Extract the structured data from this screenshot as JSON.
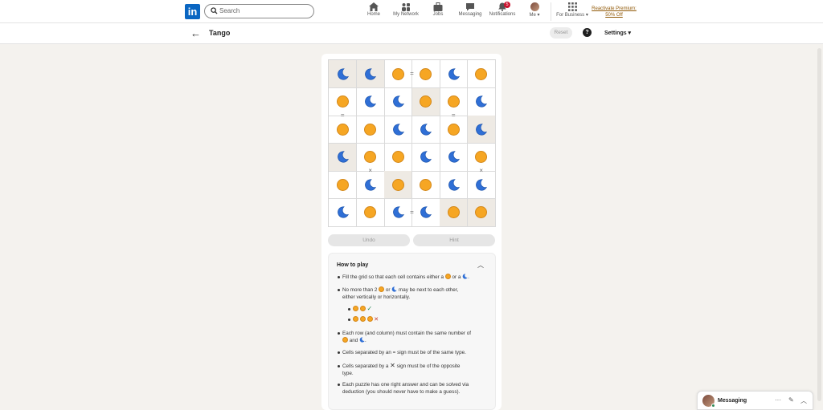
{
  "nav": {
    "logo": "in",
    "search_placeholder": "Search",
    "items": [
      {
        "label": "Home",
        "icon": "home-icon"
      },
      {
        "label": "My Network",
        "icon": "network-icon"
      },
      {
        "label": "Jobs",
        "icon": "briefcase-icon"
      },
      {
        "label": "Messaging",
        "icon": "chat-icon"
      },
      {
        "label": "Notifications",
        "icon": "bell-icon",
        "badge": "5"
      },
      {
        "label": "Me ▾",
        "icon": "avatar"
      }
    ],
    "business": "For Business ▾",
    "premium_line1": "Reactivate Premium:",
    "premium_line2": "50% Off"
  },
  "header": {
    "back": "←",
    "title": "Tango",
    "reset": "Reset",
    "help": "?",
    "settings": "Settings ▾"
  },
  "grid": {
    "size": 6,
    "cells": [
      [
        "moon",
        "moon",
        "sun",
        "sun",
        "moon",
        "sun"
      ],
      [
        "sun",
        "moon",
        "moon",
        "sun",
        "sun",
        "moon"
      ],
      [
        "sun",
        "sun",
        "moon",
        "moon",
        "sun",
        "moon"
      ],
      [
        "moon",
        "sun",
        "sun",
        "moon",
        "moon",
        "sun"
      ],
      [
        "sun",
        "moon",
        "sun",
        "sun",
        "moon",
        "moon"
      ],
      [
        "moon",
        "sun",
        "moon",
        "moon",
        "sun",
        "sun"
      ]
    ],
    "locked": [
      [
        0,
        0
      ],
      [
        0,
        1
      ],
      [
        1,
        3
      ],
      [
        2,
        5
      ],
      [
        3,
        0
      ],
      [
        4,
        2
      ],
      [
        5,
        4
      ],
      [
        5,
        5
      ]
    ],
    "signs": [
      {
        "type": "=",
        "between": [
          [
            0,
            2
          ],
          [
            0,
            3
          ]
        ]
      },
      {
        "type": "=",
        "between": [
          [
            1,
            0
          ],
          [
            2,
            0
          ]
        ]
      },
      {
        "type": "=",
        "between": [
          [
            1,
            4
          ],
          [
            2,
            4
          ]
        ]
      },
      {
        "type": "×",
        "between": [
          [
            3,
            1
          ],
          [
            4,
            1
          ]
        ]
      },
      {
        "type": "×",
        "between": [
          [
            3,
            5
          ],
          [
            4,
            5
          ]
        ]
      },
      {
        "type": "=",
        "between": [
          [
            5,
            2
          ],
          [
            5,
            3
          ]
        ]
      }
    ]
  },
  "buttons": {
    "undo": "Undo",
    "hint": "Hint"
  },
  "howto": {
    "title": "How to play",
    "rule1_a": "Fill the grid so that each cell contains either a",
    "rule1_b": "or a",
    "rule1_c": ".",
    "rule2_a": "No more than 2",
    "rule2_b": "or",
    "rule2_c": "may be next to each other,",
    "rule2_d": "either vertically or horizontally.",
    "ok_mark": "✓",
    "bad_mark": "✕",
    "rule3_a": "Each row (and column) must contain the same number of",
    "rule3_b": "and",
    "rule3_c": ".",
    "rule4": "Cells separated by an = sign must be of the same type.",
    "rule5_a": "Cells separated by a",
    "rule5_x": "✕",
    "rule5_b": "sign must be of the opposite",
    "rule5_c": "type.",
    "rule6_a": "Each puzzle has one right answer and can be solved via",
    "rule6_b": "deduction (you should never have to make a guess)."
  },
  "messaging": {
    "label": "Messaging",
    "more": "···",
    "compose": "✎",
    "collapse": "︿"
  },
  "colors": {
    "sun": "#f6a623",
    "moon": "#2f6fd6",
    "linkedin": "#0a66c2"
  }
}
